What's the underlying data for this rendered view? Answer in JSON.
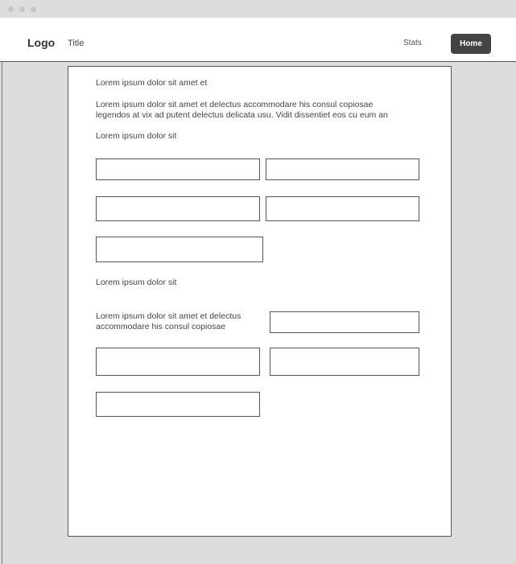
{
  "window": {
    "controls": [
      "close-dot",
      "minimize-dot",
      "maximize-dot"
    ]
  },
  "navbar": {
    "logo": "Logo",
    "title": "Title",
    "links": {
      "stats": "Stats",
      "home": "Home"
    }
  },
  "form": {
    "heading": "Lorem ipsum dolor sit amet et",
    "description": [
      "Lorem ipsum dolor sit amet et delectus accommodare his consul copiosae",
      "legendos at vix ad putent delectus delicata usu. Vidit dissentiet eos cu eum an"
    ],
    "section1": {
      "label": "Lorem ipsum dolor sit",
      "fields": [
        {
          "value": "",
          "placeholder": ""
        },
        {
          "value": "",
          "placeholder": ""
        },
        {
          "value": "",
          "placeholder": ""
        },
        {
          "value": "",
          "placeholder": ""
        },
        {
          "value": "",
          "placeholder": ""
        }
      ]
    },
    "section2": {
      "label": "Lorem ipsum dolor sit",
      "field_label": [
        "Lorem ipsum dolor sit amet et delectus",
        "accommodare his consul copiosae"
      ],
      "fields": [
        {
          "value": "",
          "placeholder": ""
        },
        {
          "value": "",
          "placeholder": ""
        },
        {
          "value": "",
          "placeholder": ""
        },
        {
          "value": "",
          "placeholder": ""
        }
      ]
    }
  },
  "colors": {
    "background": "#dddddd",
    "surface": "#ffffff",
    "border": "#555555",
    "text": "#444444",
    "primary_button": "#444444"
  }
}
